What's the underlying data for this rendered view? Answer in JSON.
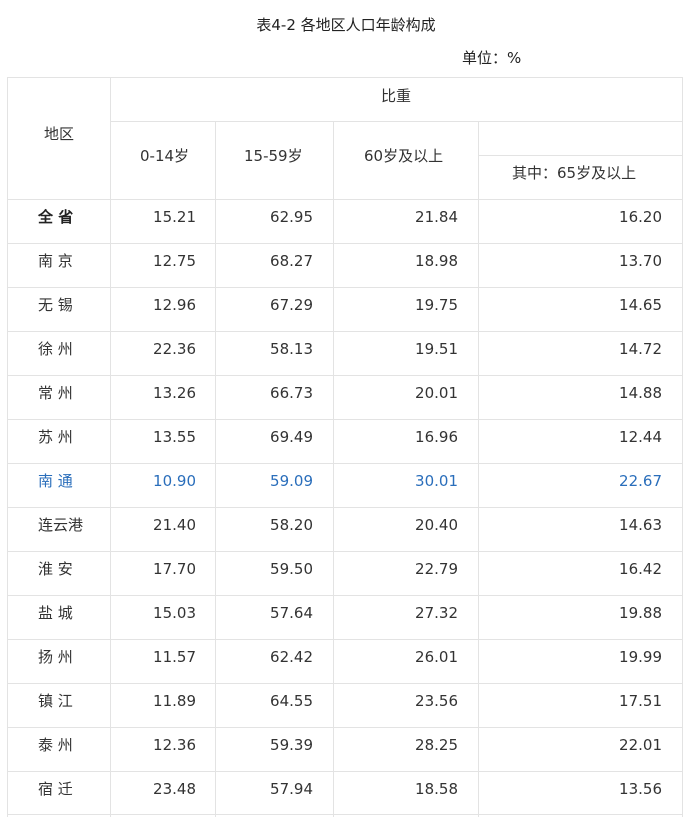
{
  "title": "表4-2  各地区人口年龄构成",
  "unit": "单位：%",
  "header": {
    "region": "地区",
    "ratio": "比重",
    "c1": "0-14岁",
    "c2": "15-59岁",
    "c3": "60岁及以上",
    "c4": "其中：65岁及以上"
  },
  "highlight_color": "#2a6ebb",
  "rows": [
    {
      "region": "全 省",
      "c1": "15.21",
      "c2": "62.95",
      "c3": "21.84",
      "c4": "16.20"
    },
    {
      "region": "南 京",
      "c1": "12.75",
      "c2": "68.27",
      "c3": "18.98",
      "c4": "13.70"
    },
    {
      "region": "无 锡",
      "c1": "12.96",
      "c2": "67.29",
      "c3": "19.75",
      "c4": "14.65"
    },
    {
      "region": "徐 州",
      "c1": "22.36",
      "c2": "58.13",
      "c3": "19.51",
      "c4": "14.72"
    },
    {
      "region": "常 州",
      "c1": "13.26",
      "c2": "66.73",
      "c3": "20.01",
      "c4": "14.88"
    },
    {
      "region": "苏 州",
      "c1": "13.55",
      "c2": "69.49",
      "c3": "16.96",
      "c4": "12.44"
    },
    {
      "region": "南 通",
      "c1": "10.90",
      "c2": "59.09",
      "c3": "30.01",
      "c4": "22.67"
    },
    {
      "region": "连云港",
      "c1": "21.40",
      "c2": "58.20",
      "c3": "20.40",
      "c4": "14.63"
    },
    {
      "region": "淮 安",
      "c1": "17.70",
      "c2": "59.50",
      "c3": "22.79",
      "c4": "16.42"
    },
    {
      "region": "盐 城",
      "c1": "15.03",
      "c2": "57.64",
      "c3": "27.32",
      "c4": "19.88"
    },
    {
      "region": "扬 州",
      "c1": "11.57",
      "c2": "62.42",
      "c3": "26.01",
      "c4": "19.99"
    },
    {
      "region": "镇 江",
      "c1": "11.89",
      "c2": "64.55",
      "c3": "23.56",
      "c4": "17.51"
    },
    {
      "region": "泰 州",
      "c1": "12.36",
      "c2": "59.39",
      "c3": "28.25",
      "c4": "22.01"
    },
    {
      "region": "宿 迁",
      "c1": "23.48",
      "c2": "57.94",
      "c3": "18.58",
      "c4": "13.56"
    }
  ]
}
